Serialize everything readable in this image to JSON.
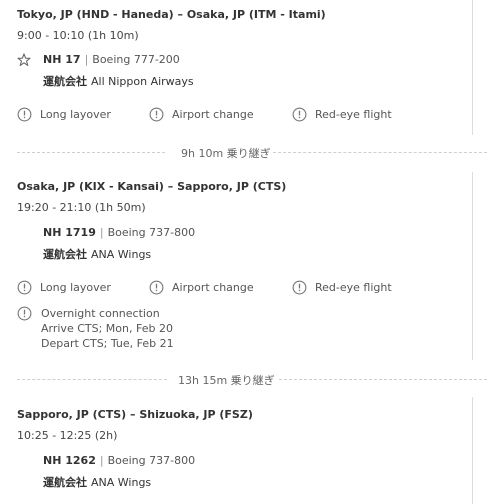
{
  "segments": [
    {
      "route": "Tokyo, JP (HND - Haneda) –  Osaka, JP (ITM - Itami)",
      "time": "9:00 - 10:10 (1h 10m)",
      "flight_number": "NH 17",
      "aircraft": "Boeing 777-200",
      "operator_label": "運航会社",
      "operator": "All Nippon Airways",
      "warnings": [
        "Long layover",
        "Airport change",
        "Red-eye flight"
      ]
    },
    {
      "route": "Osaka, JP (KIX - Kansai) –  Sapporo, JP (CTS)",
      "time": "19:20 - 21:10 (1h 50m)",
      "flight_number": "NH 1719",
      "aircraft": "Boeing 737-800",
      "operator_label": "運航会社",
      "operator": "ANA Wings",
      "warnings": [
        "Long layover",
        "Airport change",
        "Red-eye flight"
      ],
      "overnight": {
        "title": "Overnight connection",
        "arrive": "Arrive CTS; Mon, Feb 20",
        "depart": "Depart CTS; Tue, Feb 21"
      }
    },
    {
      "route": "Sapporo, JP (CTS) –  Shizuoka, JP (FSZ)",
      "time": "10:25 - 12:25 (2h)",
      "flight_number": "NH 1262",
      "aircraft": "Boeing 737-800",
      "operator_label": "運航会社",
      "operator": "ANA Wings"
    }
  ],
  "layovers": [
    "9h 10m 乗り継ぎ",
    "13h 15m 乗り継ぎ"
  ],
  "icons": {
    "airline": "star-icon",
    "warning": "alert-circle-icon"
  },
  "colors": {
    "text": "#333333",
    "muted": "#555555",
    "divider": "#cfcfcf"
  }
}
